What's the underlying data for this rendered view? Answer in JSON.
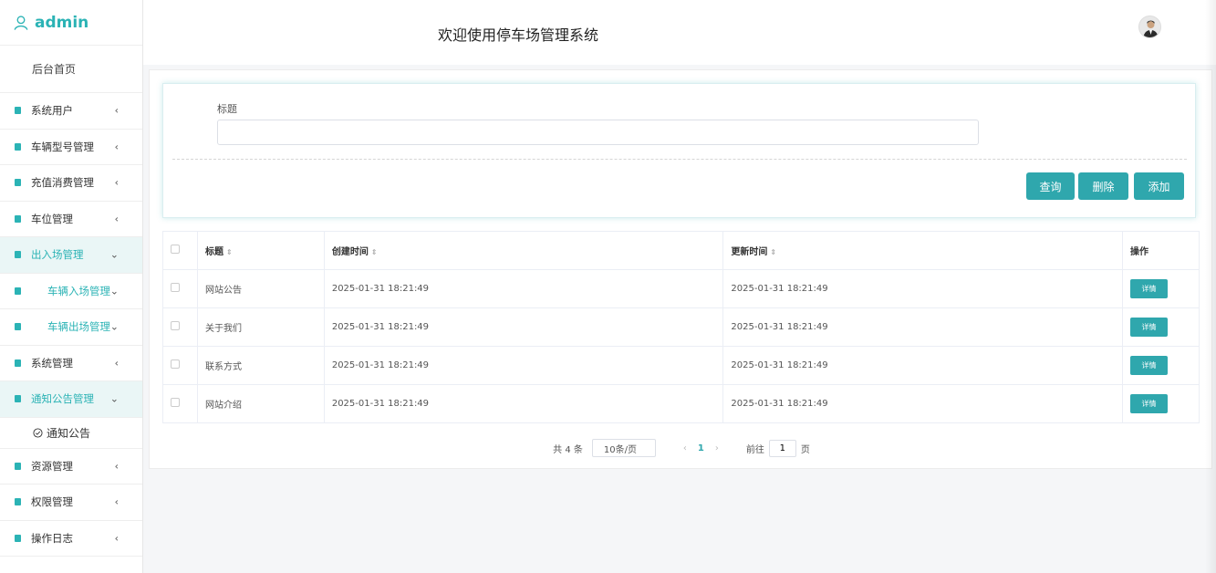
{
  "brand": {
    "name": "admin"
  },
  "sidebar": {
    "home": "后台首页",
    "items": [
      {
        "label": "系统用户",
        "arrow": "‹",
        "state": "collapsed"
      },
      {
        "label": "车辆型号管理",
        "arrow": "‹",
        "state": "collapsed"
      },
      {
        "label": "充值消费管理",
        "arrow": "‹",
        "state": "collapsed"
      },
      {
        "label": "车位管理",
        "arrow": "‹",
        "state": "collapsed"
      },
      {
        "label": "出入场管理",
        "arrow": "⌄",
        "state": "open"
      },
      {
        "label": "车辆入场管理",
        "arrow": "⌄",
        "state": "sub"
      },
      {
        "label": "车辆出场管理",
        "arrow": "⌄",
        "state": "sub"
      },
      {
        "label": "系统管理",
        "arrow": "‹",
        "state": "collapsed"
      },
      {
        "label": "通知公告管理",
        "arrow": "⌄",
        "state": "open"
      },
      {
        "label": "资源管理",
        "arrow": "‹",
        "state": "collapsed"
      },
      {
        "label": "权限管理",
        "arrow": "‹",
        "state": "collapsed"
      },
      {
        "label": "操作日志",
        "arrow": "‹",
        "state": "collapsed"
      }
    ],
    "leaf": {
      "label": "通知公告"
    }
  },
  "header": {
    "title": "欢迎使用停车场管理系统"
  },
  "search": {
    "label": "标题",
    "value": "",
    "placeholder": ""
  },
  "buttons": {
    "query": "查询",
    "delete": "删除",
    "add": "添加"
  },
  "table": {
    "columns": [
      "标题",
      "创建时间",
      "更新时间",
      "操作"
    ],
    "rows": [
      {
        "title": "网站公告",
        "created": "2025-01-31 18:21:49",
        "updated": "2025-01-31 18:21:49",
        "action": "详情"
      },
      {
        "title": "关于我们",
        "created": "2025-01-31 18:21:49",
        "updated": "2025-01-31 18:21:49",
        "action": "详情"
      },
      {
        "title": "联系方式",
        "created": "2025-01-31 18:21:49",
        "updated": "2025-01-31 18:21:49",
        "action": "详情"
      },
      {
        "title": "网站介绍",
        "created": "2025-01-31 18:21:49",
        "updated": "2025-01-31 18:21:49",
        "action": "详情"
      }
    ]
  },
  "pager": {
    "total": "共 4 条",
    "page_size": "10条/页",
    "prev": "‹",
    "current": "1",
    "next": "›",
    "goto_prefix": "前往",
    "goto_value": "1",
    "goto_suffix": "页"
  },
  "colors": {
    "accent": "#2fa7ad",
    "brand": "#2bb3b5"
  }
}
